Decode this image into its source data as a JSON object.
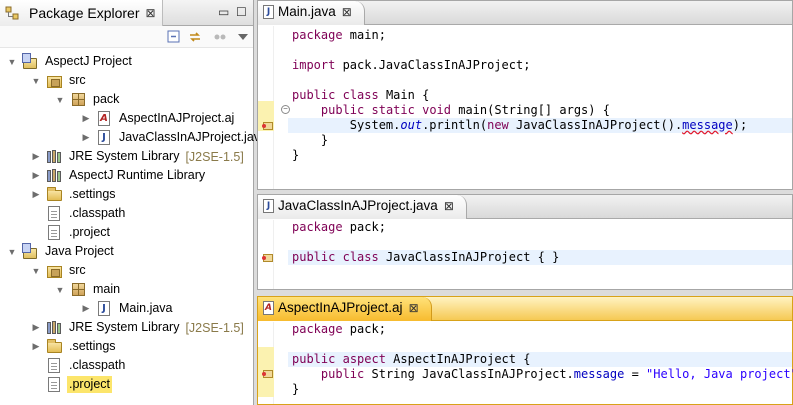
{
  "package_explorer": {
    "title": "Package Explorer",
    "close_glyph": "⊠",
    "minimize_glyph": "▭",
    "maximize_glyph": "☐",
    "toolbar_icons": [
      "collapse-all-icon",
      "link-with-editor-icon",
      "view-menu-icon"
    ],
    "items": [
      {
        "label": "AspectJ Project",
        "decoration": "",
        "icon": "aspectj-project-icon",
        "twisty": "▼"
      },
      {
        "label": "src",
        "decoration": "",
        "icon": "source-folder-icon",
        "twisty": "▼"
      },
      {
        "label": "pack",
        "decoration": "",
        "icon": "package-icon",
        "twisty": "▼"
      },
      {
        "label": "AspectInAJProject.aj",
        "decoration": "",
        "icon": "aspect-file-icon",
        "twisty": "▶"
      },
      {
        "label": "JavaClassInAJProject.java",
        "decoration": "",
        "icon": "java-file-icon",
        "twisty": "▶"
      },
      {
        "label": "JRE System Library",
        "decoration": "[J2SE-1.5]",
        "icon": "library-icon",
        "twisty": "▶"
      },
      {
        "label": "AspectJ Runtime Library",
        "decoration": "",
        "icon": "library-icon",
        "twisty": "▶"
      },
      {
        "label": ".settings",
        "decoration": "",
        "icon": "folder-icon",
        "twisty": "▶"
      },
      {
        "label": ".classpath",
        "decoration": "",
        "icon": "file-icon",
        "twisty": ""
      },
      {
        "label": ".project",
        "decoration": "",
        "icon": "file-icon",
        "twisty": ""
      },
      {
        "label": "Java Project",
        "decoration": "",
        "icon": "java-project-icon",
        "twisty": "▼"
      },
      {
        "label": "src",
        "decoration": "",
        "icon": "source-folder-icon",
        "twisty": "▼"
      },
      {
        "label": "main",
        "decoration": "",
        "icon": "package-icon",
        "twisty": "▼"
      },
      {
        "label": "Main.java",
        "decoration": "",
        "icon": "java-file-icon",
        "twisty": "▶"
      },
      {
        "label": "JRE System Library",
        "decoration": "[J2SE-1.5]",
        "icon": "library-icon",
        "twisty": "▶"
      },
      {
        "label": ".settings",
        "decoration": "",
        "icon": "folder-icon",
        "twisty": "▶"
      },
      {
        "label": ".classpath",
        "decoration": "",
        "icon": "file-icon",
        "twisty": ""
      },
      {
        "label": ".project",
        "decoration": "",
        "icon": "file-icon",
        "twisty": ""
      }
    ]
  },
  "editors": [
    {
      "tab_title": "Main.java",
      "close_glyph": "⊠",
      "lines": [
        "package main;",
        "",
        "import pack.JavaClassInAJProject;",
        "",
        "public class Main {",
        "    public static void main(String[] args) {",
        "        System.out.println(new JavaClassInAJProject().message);",
        "    }",
        "}"
      ]
    },
    {
      "tab_title": "JavaClassInAJProject.java",
      "close_glyph": "⊠",
      "lines": [
        "package pack;",
        "",
        "public class JavaClassInAJProject { }"
      ]
    },
    {
      "tab_title": "AspectInAJProject.aj",
      "close_glyph": "⊠",
      "lines": [
        "package pack;",
        "",
        "public aspect AspectInAJProject {",
        "    public String JavaClassInAJProject.message = \"Hello, Java project\";",
        "}"
      ]
    }
  ],
  "colors": {
    "keyword": "#7f0055",
    "string": "#2a00ff",
    "field": "#0000c0",
    "selection": "#fce56b",
    "active_tab": "#f7bb2e",
    "current_line": "#e8f2fe",
    "error_underline": "#e2172b"
  }
}
